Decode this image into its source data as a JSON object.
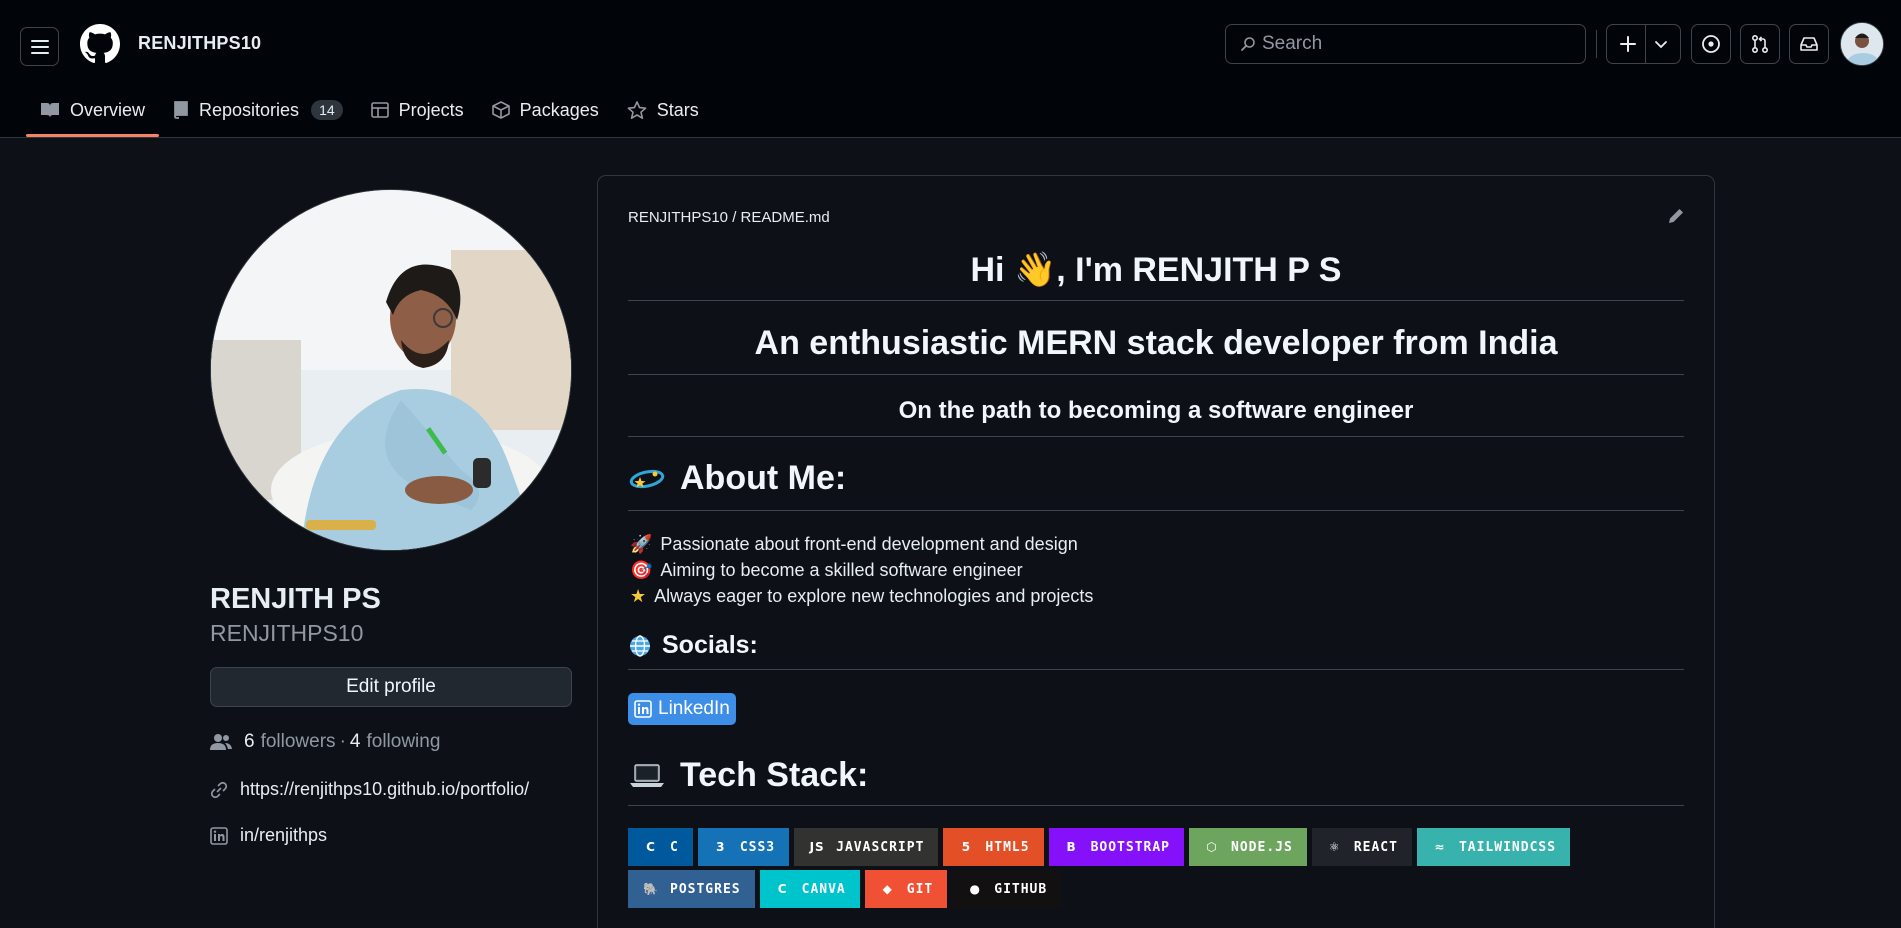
{
  "header": {
    "username": "RENJITHPS10",
    "search_placeholder": "Search"
  },
  "tabs": [
    {
      "label": "Overview",
      "active": true
    },
    {
      "label": "Repositories",
      "count": "14"
    },
    {
      "label": "Projects"
    },
    {
      "label": "Packages"
    },
    {
      "label": "Stars"
    }
  ],
  "profile": {
    "full_name": "RENJITH PS",
    "login": "RENJITHPS10",
    "edit_label": "Edit profile",
    "followers_count": "6",
    "followers_label": "followers",
    "following_count": "4",
    "following_label": "following",
    "website": "https://renjithps10.github.io/portfolio/",
    "linkedin": "in/renjithps"
  },
  "readme": {
    "path": "RENJITHPS10 / README.md",
    "h1": "Hi 👋, I'm RENJITH P S",
    "h2": "An enthusiastic MERN stack developer from India",
    "h3": "On the path to becoming a software engineer",
    "about_title": "About Me:",
    "about_items": [
      {
        "emoji": "🚀",
        "text": "Passionate about front-end development and design"
      },
      {
        "emoji": "🎯",
        "text": "Aiming to become a skilled software engineer"
      },
      {
        "emoji": "★",
        "text": "Always eager to explore new technologies and projects"
      }
    ],
    "socials_title": "Socials:",
    "linkedin_badge": "LinkedIn",
    "tech_title": "Tech Stack:",
    "badges_row1": [
      {
        "label": "C",
        "color": "#00599C",
        "icon": "C"
      },
      {
        "label": "CSS3",
        "color": "#1572B6",
        "icon": "3"
      },
      {
        "label": "JAVASCRIPT",
        "color": "#323330",
        "icon": "JS"
      },
      {
        "label": "HTML5",
        "color": "#E34F26",
        "icon": "5"
      },
      {
        "label": "BOOTSTRAP",
        "color": "#8511FA",
        "icon": "B"
      },
      {
        "label": "NODE.JS",
        "color": "#6DA55F",
        "icon": "⬡"
      },
      {
        "label": "REACT",
        "color": "#20232A",
        "icon": "⚛"
      },
      {
        "label": "TAILWINDCSS",
        "color": "#38B2AC",
        "icon": "≈"
      }
    ],
    "badges_row2": [
      {
        "label": "POSTGRES",
        "color": "#316192",
        "icon": "🐘"
      },
      {
        "label": "CANVA",
        "color": "#00C4CC",
        "icon": "C"
      },
      {
        "label": "GIT",
        "color": "#F05033",
        "icon": "◆"
      },
      {
        "label": "GITHUB",
        "color": "#121011",
        "icon": "●"
      }
    ]
  }
}
